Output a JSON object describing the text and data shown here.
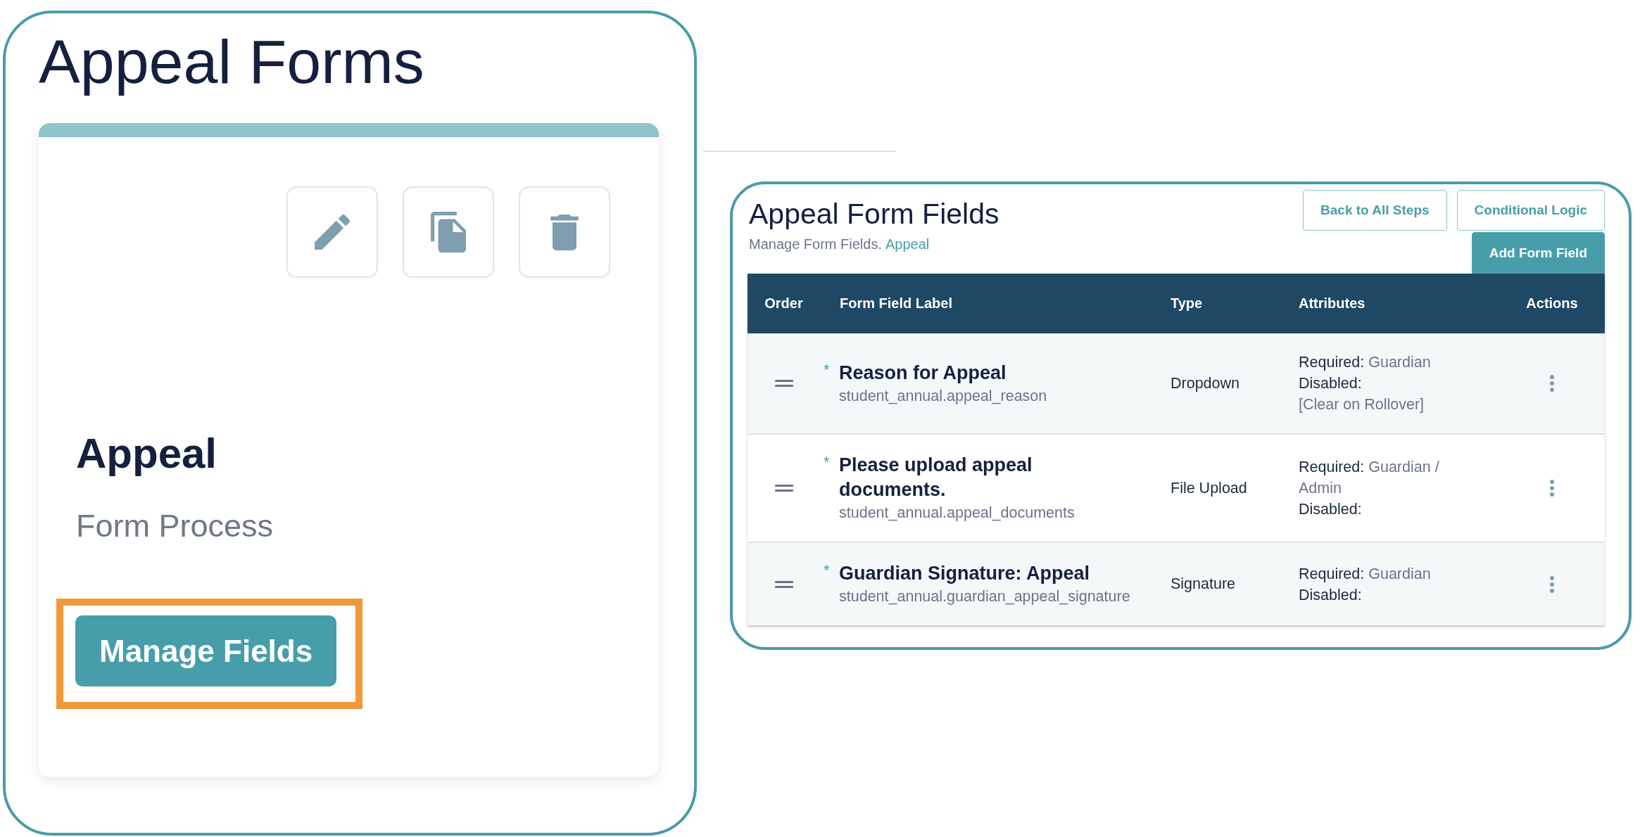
{
  "page_title": "Appeal Forms",
  "form_card": {
    "name": "Appeal",
    "subtitle": "Form Process",
    "button": "Manage Fields",
    "highlighted": true
  },
  "fields_panel": {
    "title": "Appeal Form Fields",
    "subtitle": "Manage Form Fields.",
    "link": "Appeal",
    "buttons": [
      {
        "label": "Back to All Steps",
        "kind": "outline"
      },
      {
        "label": "Conditional Logic",
        "kind": "outline"
      },
      {
        "label": "Add Form Field",
        "kind": "filled"
      }
    ]
  },
  "table": {
    "columns": [
      "Order",
      "Form Field Label",
      "Type",
      "Attributes",
      "Actions"
    ],
    "rows": [
      {
        "required_mark": "*",
        "label": "Reason for Appeal",
        "key": "student_annual.appeal_reason",
        "type": "Dropdown",
        "attributes": [
          {
            "name": "Required:",
            "value": "Guardian"
          },
          {
            "name": "Disabled:"
          }
        ],
        "note": "[Clear on Rollover]"
      },
      {
        "required_mark": "*",
        "label": "Please upload appeal documents.",
        "key": "student_annual.appeal_documents",
        "type": "File Upload",
        "attributes": [
          {
            "name": "Required:",
            "value": "Guardian / Admin"
          },
          {
            "name": "Disabled:"
          }
        ]
      },
      {
        "required_mark": "*",
        "label": "Guardian Signature: Appeal",
        "key": "student_annual.guardian_appeal_signature",
        "type": "Signature",
        "attributes": [
          {
            "name": "Required:",
            "value": "Guardian"
          },
          {
            "name": "Disabled:"
          }
        ]
      }
    ]
  }
}
